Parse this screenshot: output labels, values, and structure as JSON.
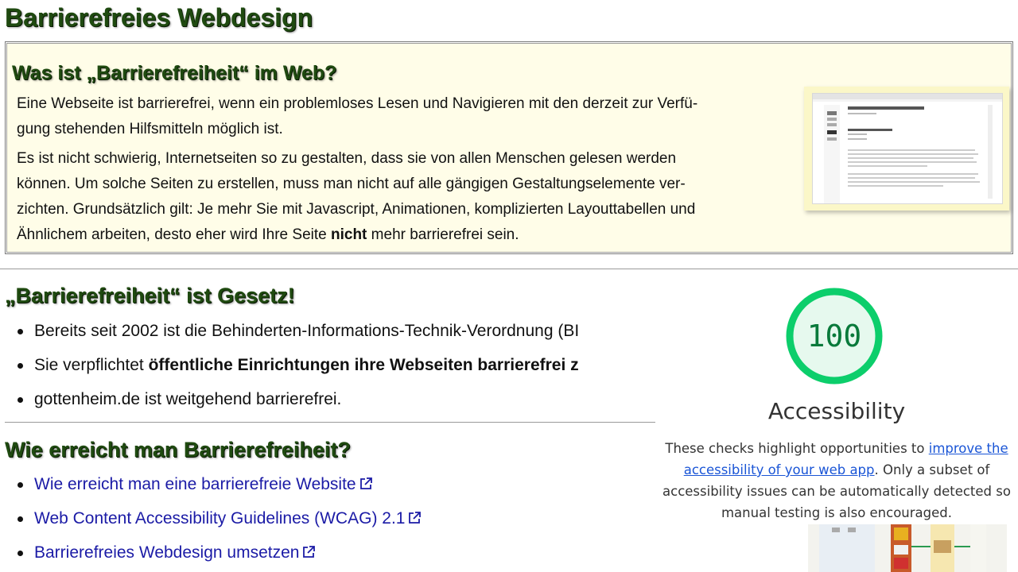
{
  "page": {
    "title": "Barrierefreies Webdesign"
  },
  "intro": {
    "heading": "Was ist „Barrierefreiheit“ im Web?",
    "p1_line1": "Eine Webseite ist barrierefrei, wenn ein problemloses Lesen und Navigieren mit den derzeit zur Verfü-",
    "p1_line2": "gung stehenden Hilfsmitteln möglich ist.",
    "p2_line1": "Es ist nicht schwierig, Internetseiten so zu gestalten, dass sie von allen Menschen gelesen werden",
    "p2_line2": "können. Um solche Seiten zu erstellen, muss man nicht auf alle gängigen Gestaltungselemente ver-",
    "p2_line3": "zichten. Grundsätzlich gilt: Je mehr Sie mit Javascript, Animationen, komplizierten Layouttabellen und",
    "p2_line4_before": "Ähnlichem arbeiten, desto eher wird Ihre Seite ",
    "p2_line4_bold": "nicht",
    "p2_line4_after": " mehr barrierefrei sein.",
    "thumbnail": {
      "title": "Barrierefreies Webdesign gottenheim.de"
    }
  },
  "law": {
    "heading": "„Barrierefreiheit“ ist Gesetz!",
    "item1": "Bereits seit 2002 ist die Behinderten-Informations-Technik-Verordnung (BI",
    "item2_before": "Sie verpflichtet ",
    "item2_bold": "öffentliche Einrichtungen ihre Webseiten barrierefrei z",
    "item3": "gottenheim.de ist weitgehend barrierefrei."
  },
  "how": {
    "heading": "Wie erreicht man Barrierefreiheit?",
    "links": [
      "Wie erreicht man eine barrierefreie Website",
      "Web Content Accessibility Guidelines (WCAG) 2.1",
      "Barrierefreies Webdesign umsetzen"
    ]
  },
  "lighthouse": {
    "score": "100",
    "score_fraction": 1.0,
    "gauge_color": "#0cce6b",
    "gauge_bg": "#e6f9ee",
    "title": "Accessibility",
    "desc_before": "These checks highlight opportunities to ",
    "desc_link": "improve the accessibility of your web app",
    "desc_after": ". Only a subset of accessibility issues can be automatically detected so manual testing is also encouraged."
  },
  "colors": {
    "heading": "#1f4a10",
    "infobox_bg": "#fffde8",
    "link": "#1b1ba6"
  }
}
